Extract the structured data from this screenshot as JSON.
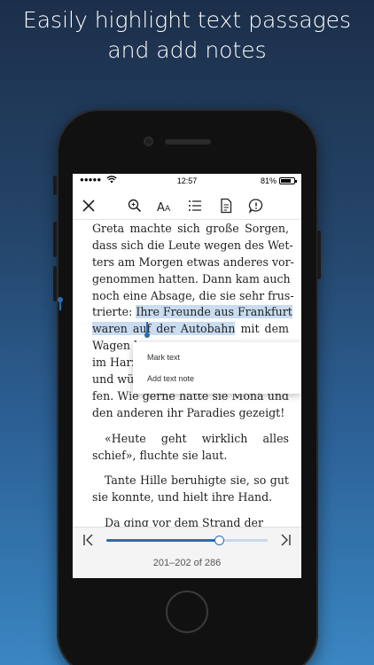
{
  "headline": {
    "line1": "Easily highlight text passages",
    "line2": "and add notes"
  },
  "statusbar": {
    "signal": "●●●●●",
    "time": "12:57",
    "battery_percent": "81%",
    "battery_level": 0.81
  },
  "toolbar": {
    "icons": [
      "close-icon",
      "search-icon",
      "font-size-icon",
      "table-of-contents-icon",
      "page-icon",
      "notes-icon"
    ]
  },
  "book": {
    "para1_lines": [
      "Greta machte sich große Sorgen,",
      "dass sich die Leute wegen des Wet-",
      "ters am Morgen etwas anderes vor-",
      "genommen hatten. Dann kam auch",
      "noch eine Absage, die sie sehr frus-"
    ],
    "line6_pre": "trierte: ",
    "line6_hl": "Ihre Freunde aus Frankfurt",
    "line7_hl": "waren auf der Autobahn",
    "line7_post": " mit dem",
    "para1_rest": [
      "Wagen l",
      "im Harz",
      "und wü",
      "fen. Wie gerne hätte sie Mona und",
      "den anderen ihr Paradies gezeigt!"
    ],
    "para2_lines": [
      "«Heute geht wirklich alles",
      "schief», fluchte sie laut."
    ],
    "para3_lines": [
      "Tante Hille beruhigte sie, so gut",
      "sie konnte, und hielt ihre Hand."
    ],
    "para4_lines": [
      "Da ging vor dem Strand der"
    ]
  },
  "popup": {
    "mark_text": "Mark text",
    "add_note": "Add text note"
  },
  "progress": {
    "label": "201–202 of 286",
    "fraction": 0.7
  },
  "colors": {
    "accent": "#2a6db0",
    "highlight": "#c9dcf0"
  }
}
